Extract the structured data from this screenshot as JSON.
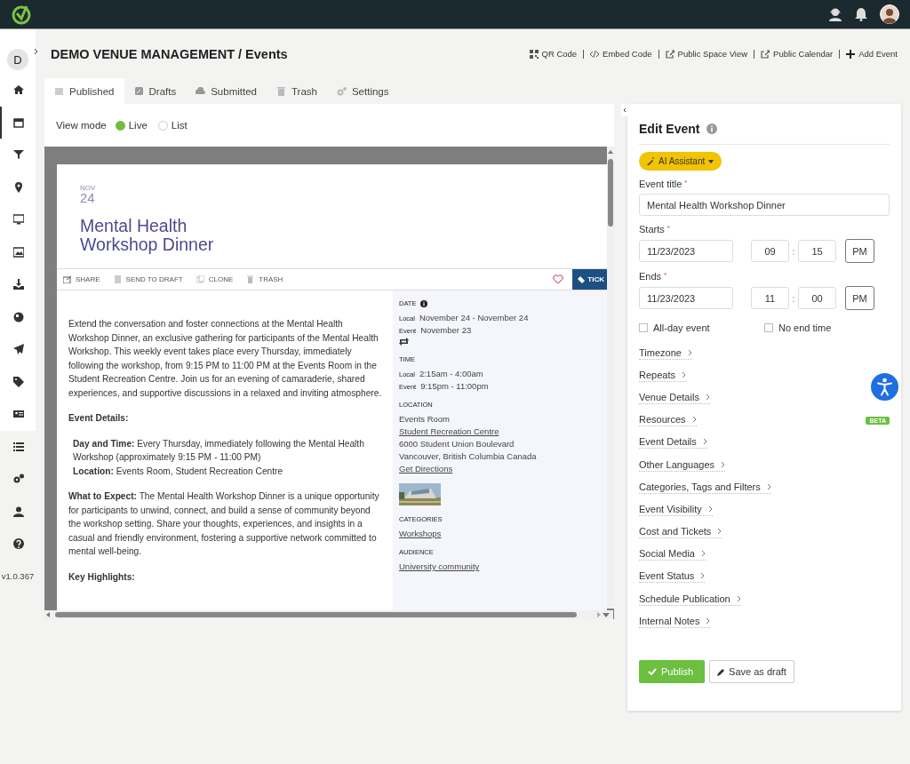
{
  "sidebar": {
    "avatar_letter": "D",
    "items": [
      {
        "selected": false
      },
      {
        "selected": true
      },
      {
        "selected": false
      },
      {
        "selected": false
      },
      {
        "selected": false
      },
      {
        "selected": false
      },
      {
        "selected": false
      },
      {
        "selected": false
      },
      {
        "selected": false
      },
      {
        "selected": false
      },
      {
        "selected": false
      },
      {
        "selected": false
      },
      {
        "selected": false
      },
      {
        "selected": false
      },
      {
        "selected": false
      }
    ],
    "version": "v1.0.367"
  },
  "header": {
    "title": "DEMO VENUE MANAGEMENT / Events",
    "actions": [
      "QR Code",
      "Embed Code",
      "Public Space View",
      "Public Calendar",
      "Add Event"
    ]
  },
  "tabs": [
    {
      "label": "Published",
      "selected": true
    },
    {
      "label": "Drafts",
      "selected": false
    },
    {
      "label": "Submitted",
      "selected": false
    },
    {
      "label": "Trash",
      "selected": false
    },
    {
      "label": "Settings",
      "selected": false
    }
  ],
  "view_mode": {
    "label": "View mode",
    "options": [
      {
        "label": "Live",
        "selected": true
      },
      {
        "label": "List",
        "selected": false
      }
    ]
  },
  "event": {
    "month": "NOV",
    "day": "24",
    "title": "Mental Health Workshop Dinner",
    "actions": [
      "SHARE",
      "SEND TO DRAFT",
      "CLONE",
      "TRASH"
    ],
    "ticket_button": "TICK",
    "description": [
      {
        "kind": "paragraph",
        "text": "Extend the conversation and foster connections at the Mental Health Workshop Dinner, an exclusive gathering for participants of the Mental Health Workshop. This weekly event takes place every Thursday, immediately following the workshop, from 9:15 PM to 11:00 PM at the Events Room in the Student Recreation Centre. Join us for an evening of camaraderie, shared experiences, and supportive discussions in a relaxed and inviting atmosphere."
      },
      {
        "kind": "heading",
        "text": "Event Details:"
      },
      {
        "kind": "list",
        "lines": [
          "**Day and Time:** Every Thursday, immediately following the Mental Health Workshop (approximately 9:15 PM - 11:00 PM)",
          "**Location:** Events Room, Student Recreation Centre"
        ]
      },
      {
        "kind": "paragraph",
        "text": "**What to Expect:** The Mental Health Workshop Dinner is a unique opportunity for participants to unwind, connect, and build a sense of community beyond the workshop setting. Share your thoughts, experiences, and insights in a casual and friendly environment, fostering a supportive network committed to mental well-being."
      },
      {
        "kind": "heading",
        "text": "Key Highlights:"
      }
    ],
    "details": [
      {
        "heading": "DATE",
        "kind": "date",
        "rows": [
          {
            "label": "Local",
            "value": "November 24  - November 24"
          },
          {
            "label": "Event",
            "value": "November 23"
          }
        ]
      },
      {
        "heading": "TIME",
        "kind": "rows",
        "rows": [
          {
            "label": "Local",
            "value": "2:15am  - 4:00am"
          },
          {
            "label": "Event",
            "value": "9:15pm  - 11:00pm"
          }
        ]
      },
      {
        "heading": "LOCATION",
        "kind": "location",
        "lines": [
          {
            "kind": "text",
            "text": "Events Room"
          },
          {
            "kind": "link",
            "text": "Student Recreation Centre"
          },
          {
            "kind": "text",
            "text": "6000 Student Union Boulevard"
          },
          {
            "kind": "text",
            "text": "Vancouver,  British Columbia  Canada"
          },
          {
            "kind": "link",
            "text": "Get Directions"
          }
        ]
      },
      {
        "heading": "CATEGORIES",
        "kind": "links",
        "lines": [
          {
            "kind": "link",
            "text": "Workshops"
          }
        ]
      },
      {
        "heading": "AUDIENCE",
        "kind": "links",
        "lines": [
          {
            "kind": "link",
            "text": "University community"
          }
        ]
      }
    ]
  },
  "edit_panel": {
    "title": "Edit Event",
    "ai_button": "AI Assistant",
    "title_field": {
      "label": "Event title",
      "required_mark": "*",
      "value": "Mental Health Workshop Dinner"
    },
    "times": [
      {
        "label": "Starts",
        "required_mark": "*",
        "date": "11/23/2023",
        "hour": "09",
        "separator": ":",
        "minute": "15",
        "ampm": "PM"
      },
      {
        "label": "Ends",
        "required_mark": "*",
        "date": "11/23/2023",
        "hour": "11",
        "separator": ":",
        "minute": "00",
        "ampm": "PM"
      }
    ],
    "checkboxes": [
      {
        "label": "All-day event",
        "checked": false
      },
      {
        "label": "No end time",
        "checked": false
      }
    ],
    "sections": [
      {
        "label": "Timezone"
      },
      {
        "label": "Repeats"
      },
      {
        "label": "Venue Details"
      },
      {
        "label": "Resources",
        "badge": "BETA"
      },
      {
        "label": "Event Details"
      },
      {
        "label": "Other Languages"
      },
      {
        "label": "Categories, Tags and Filters"
      },
      {
        "label": "Event Visibility"
      },
      {
        "label": "Cost and Tickets"
      },
      {
        "label": "Social Media"
      },
      {
        "label": "Event Status"
      },
      {
        "label": "Schedule Publication"
      },
      {
        "label": "Internal Notes"
      }
    ],
    "publish_button": "Publish",
    "draft_button": "Save as draft"
  }
}
